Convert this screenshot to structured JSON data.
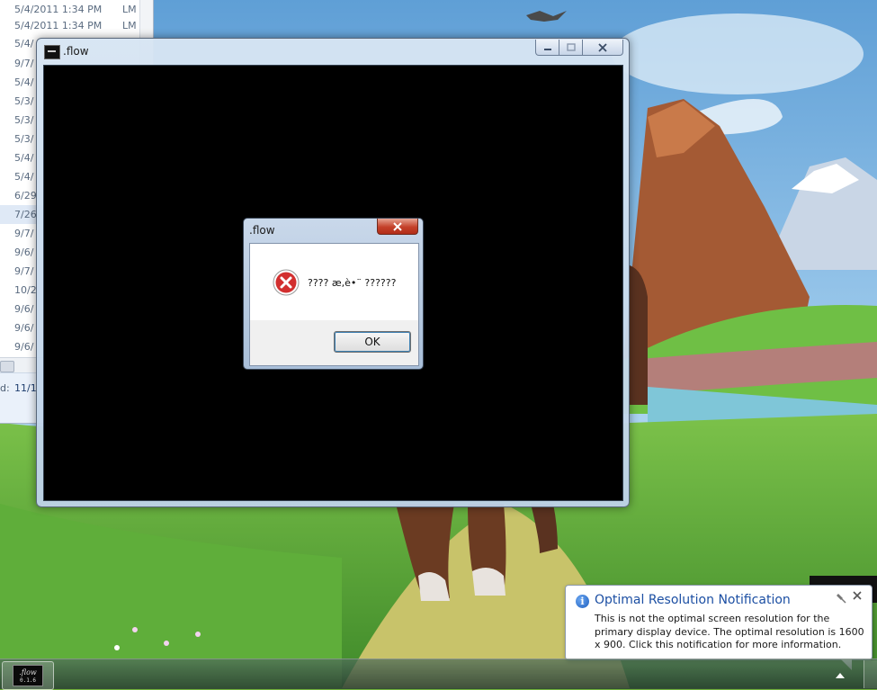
{
  "explorer": {
    "rows": [
      {
        "date": "5/4/2011 1:34 PM",
        "type": "LM"
      },
      {
        "date": "5/4/2011 1:34 PM",
        "type": "LM"
      },
      {
        "date": "5/4/",
        "type": ""
      },
      {
        "date": "9/7/",
        "type": ""
      },
      {
        "date": "5/4/",
        "type": ""
      },
      {
        "date": "5/3/",
        "type": ""
      },
      {
        "date": "5/3/",
        "type": ""
      },
      {
        "date": "5/3/",
        "type": ""
      },
      {
        "date": "5/4/",
        "type": ""
      },
      {
        "date": "5/4/",
        "type": ""
      },
      {
        "date": "6/29",
        "type": ""
      },
      {
        "date": "7/26",
        "type": ""
      },
      {
        "date": "9/7/",
        "type": ""
      },
      {
        "date": "9/6/",
        "type": ""
      },
      {
        "date": "9/7/",
        "type": ""
      },
      {
        "date": "10/2",
        "type": ""
      },
      {
        "date": "9/6/",
        "type": ""
      },
      {
        "date": "9/6/",
        "type": ""
      },
      {
        "date": "9/6/",
        "type": ""
      }
    ],
    "details_label": "d:",
    "details_value": "11/1"
  },
  "flow_window": {
    "title": ".flow",
    "icons": {
      "minimize": "minimize-icon",
      "maximize": "maximize-icon",
      "close": "close-icon"
    }
  },
  "message_box": {
    "title": ".flow",
    "message": "???? æ,è•¨ ??????",
    "ok_label": "OK",
    "icon": "error-icon"
  },
  "notification": {
    "title": "Optimal Resolution Notification",
    "text": "This is not the optimal screen resolution for the primary display device. The optimal resolution is 1600 x 900. Click this notification for more information.",
    "icons": {
      "info": "info-icon",
      "pin": "pin-icon",
      "close": "close-icon"
    }
  },
  "taskbar": {
    "app_icon_text": ".flow",
    "app_icon_version": "0.1.6"
  },
  "colors": {
    "title_blue": "#1c4fa3",
    "error_red": "#c4412a"
  }
}
